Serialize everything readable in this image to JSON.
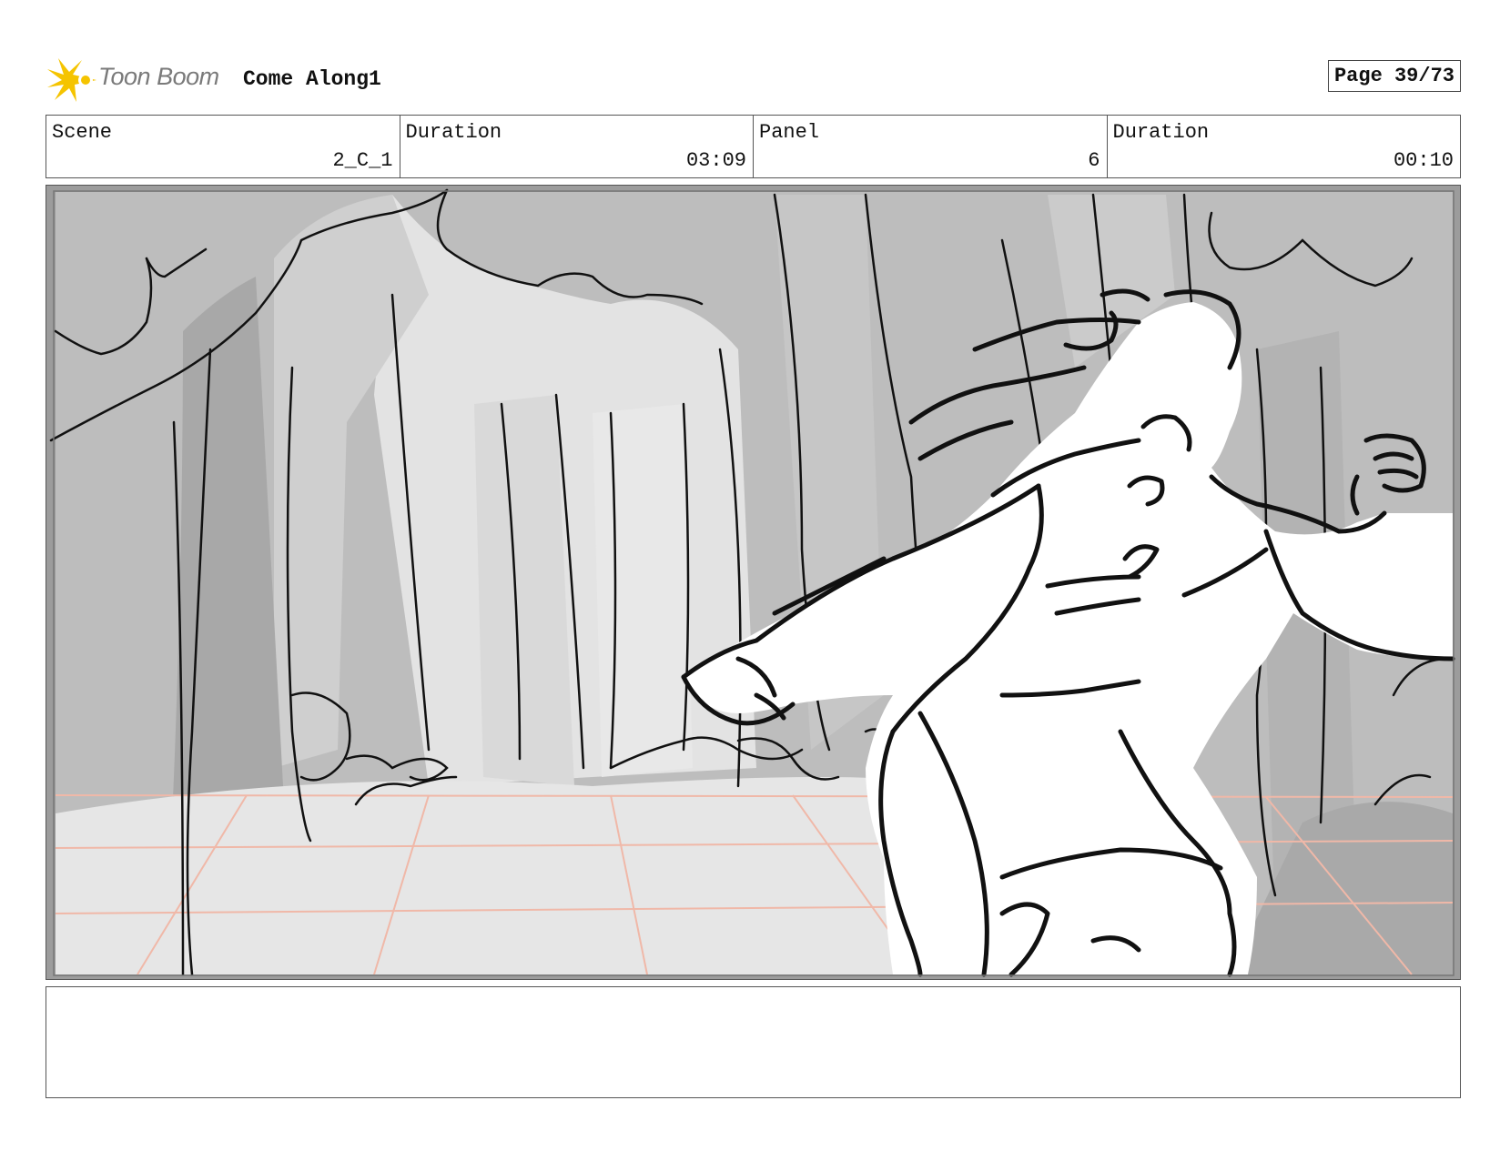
{
  "header": {
    "logo_text": "Toon Boom",
    "project_title": "Come Along1",
    "page_label": "Page 39/73"
  },
  "info": {
    "scene_label": "Scene",
    "scene_value": "2_C_1",
    "scene_duration_label": "Duration",
    "scene_duration_value": "03:09",
    "panel_label": "Panel",
    "panel_value": "6",
    "panel_duration_label": "Duration",
    "panel_duration_value": "00:10"
  },
  "panel": {
    "icon": "storyboard-sketch-forest-running-girl"
  },
  "notes": {
    "text": ""
  },
  "colors": {
    "logo_yellow": "#f5c400",
    "logo_text": "#7a7a7a",
    "guide_grid": "#f0b8a8",
    "border": "#555555"
  }
}
